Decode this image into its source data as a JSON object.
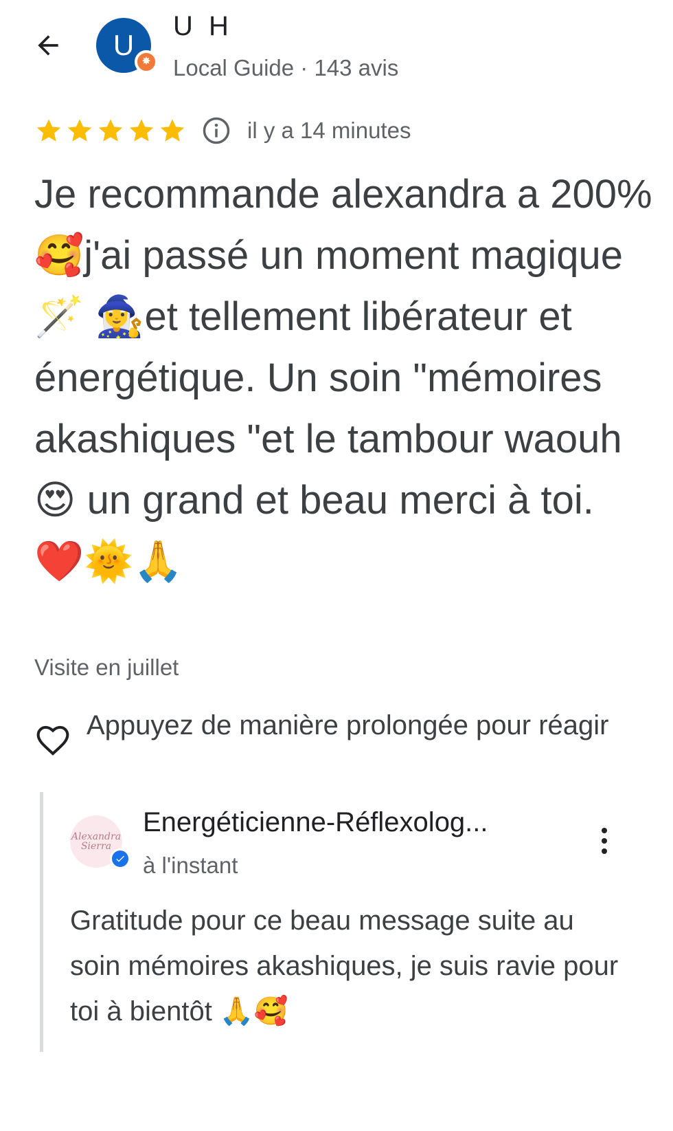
{
  "header": {
    "back_icon": "arrow-left-icon",
    "avatar_initial": "U",
    "avatar_color": "#0b57a8",
    "badge_color": "#f07a3a",
    "user_name": "U H",
    "user_meta": "Local Guide · 143 avis"
  },
  "review": {
    "rating": 5,
    "rating_max": 5,
    "star_color": "#fbbc04",
    "info_icon": "info-icon",
    "time": "il y a 14 minutes",
    "text": "Je recommande alexandra a 200% 🥰j'ai passé un moment magique 🪄 🧙‍♀️et tellement libérateur et énergétique. Un soin \"mémoires akashiques \"et le tambour waouh 😍 un grand et beau merci à toi. ❤️🌞🙏",
    "visit": "Visite en juillet"
  },
  "react": {
    "icon": "heart-outline-icon",
    "label": "Appuyez de manière prolongée pour réagir"
  },
  "owner_reply": {
    "avatar_text": "Alexandra Sierra",
    "verified_icon": "verified-check-icon",
    "verified_color": "#1a73e8",
    "name": "Energéticienne-Réflexolog...",
    "time": "à l'instant",
    "more_icon": "more-vertical-icon",
    "text": "Gratitude pour ce beau message suite au soin mémoires akashiques, je suis ravie pour toi à bientôt 🙏🥰"
  }
}
